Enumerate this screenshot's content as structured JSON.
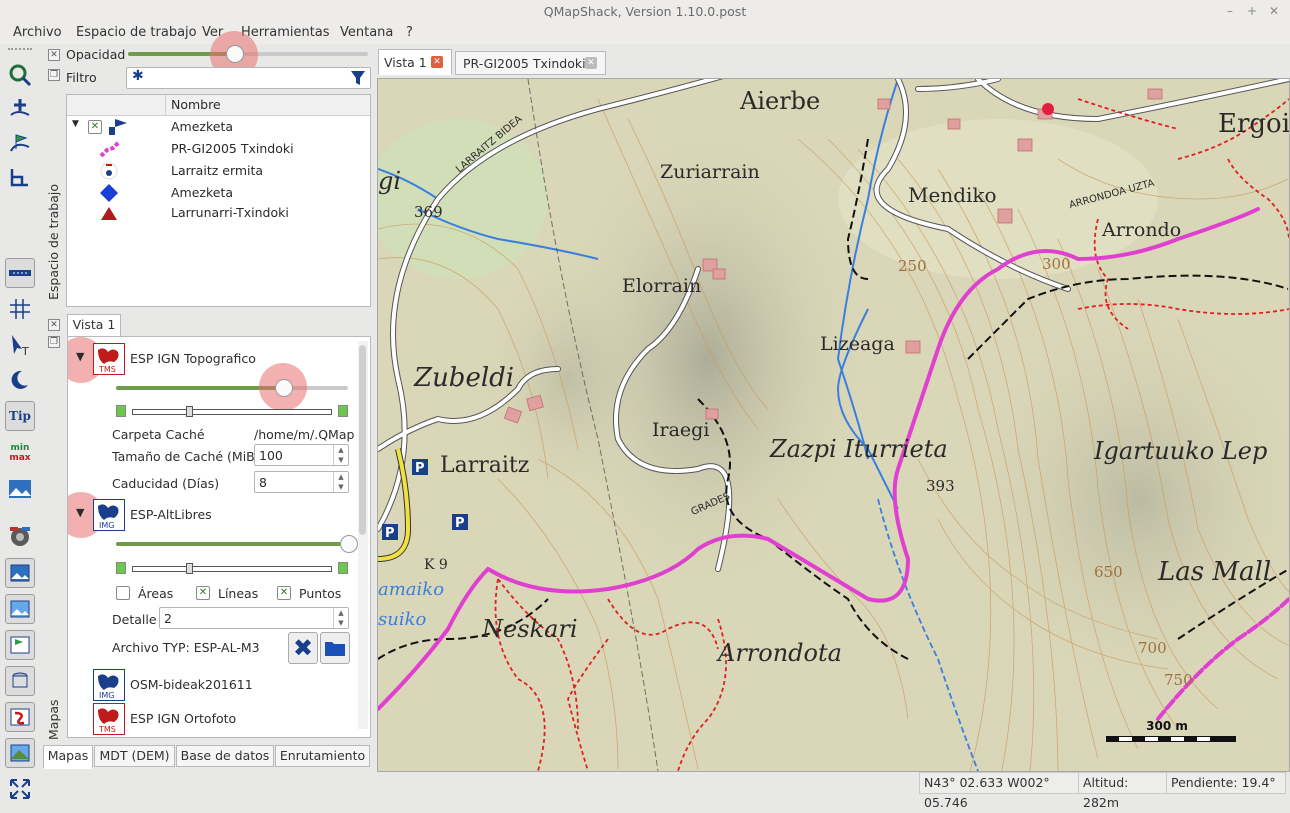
{
  "window": {
    "title": "QMapShack, Version 1.10.0.post"
  },
  "menu": [
    "Archivo",
    "Espacio de trabajo",
    "Ver",
    "Herramientas",
    "Ventana",
    "?"
  ],
  "workspace": {
    "side_label": "Espacio de trabajo",
    "opacity_label": "Opacidad",
    "filter_label": "Filtro",
    "opacity_value": 0.44,
    "tree_header": "Nombre",
    "items": [
      {
        "name": "Amezketa",
        "icon": "project-flag-icon"
      },
      {
        "name": "PR-GI2005 Txindoki",
        "icon": "track-icon"
      },
      {
        "name": "Larraitz ermita",
        "icon": "waypoint-icon"
      },
      {
        "name": "Amezketa",
        "icon": "diamond-waypoint-icon"
      },
      {
        "name": "Larrunarri-Txindoki",
        "icon": "triangle-route-icon"
      }
    ]
  },
  "maps_panel": {
    "side_label": "Mapas",
    "view_tab": "Vista 1",
    "map1": {
      "name": "ESP  IGN Topografico",
      "type": "TMS",
      "opacity": 0.72
    },
    "cache_folder_label": "Carpeta Caché",
    "cache_folder_value": "/home/m/.QMap",
    "cache_size_label": "Tamaño de Caché (MiB)",
    "cache_size_value": "100",
    "expiry_label": "Caducidad (Días)",
    "expiry_value": "8",
    "map2": {
      "name": "ESP-AltLibres",
      "type": "IMG",
      "opacity": 1.0
    },
    "areas_label": "Áreas",
    "lines_label": "Líneas",
    "points_label": "Puntos",
    "detail_label": "Detalle",
    "detail_value": "2",
    "typ_label": "Archivo TYP: ESP-AL-M3",
    "map3": {
      "name": "OSM-bideak201611",
      "type": "IMG"
    },
    "map4": {
      "name": "ESP IGN Ortofoto",
      "type": "TMS"
    },
    "bottom_tabs": [
      "Mapas",
      "MDT (DEM)",
      "Base de datos",
      "Enrutamiento"
    ]
  },
  "view_tabs": [
    "Vista 1",
    "PR-GI2005 Txindoki"
  ],
  "map_labels": {
    "aierbe": "Aierbe",
    "ergoien": "Ergoien",
    "zuriarrain": "Zuriarrain",
    "mendiko": "Mendiko",
    "arrondo": "Arrondo",
    "elorrain": "Elorrain",
    "lizeaga": "Lizeaga",
    "zubeldi": "Zubeldi",
    "larraitz": "Larraitz",
    "iraegi": "Iraegi",
    "zazpi": "Zazpi Iturrieta",
    "igartuuko": "Igartuuko Lep",
    "las_mall": "Las Mall",
    "neskari": "Neskari",
    "arrondota": "Arrondota",
    "gi": "gi",
    "alt369": "369",
    "alt393": "393",
    "alt250": "250",
    "alt300": "300",
    "alt700": "700",
    "alt750": "750",
    "alt650": "650",
    "amaiko": "amaiko",
    "suiko": "suiko",
    "k9": "K 9",
    "grades": "GRADES",
    "larraitz_bide": "LARRAITZ BIDEA",
    "arrondo_uzta": "ARRONDOA UZTA"
  },
  "scale_label": "300 m",
  "status": {
    "coords": "N43° 02.633 W002° 05.746",
    "altitude": "Altitud: 282m",
    "slope": "Pendiente: 19.4°"
  },
  "colors": {
    "track": "#e040d0",
    "trail_red": "#e02020",
    "river": "#3a7fe0",
    "map_bg": "#dcd8b8",
    "slider_fill": "#6e9c4b"
  }
}
